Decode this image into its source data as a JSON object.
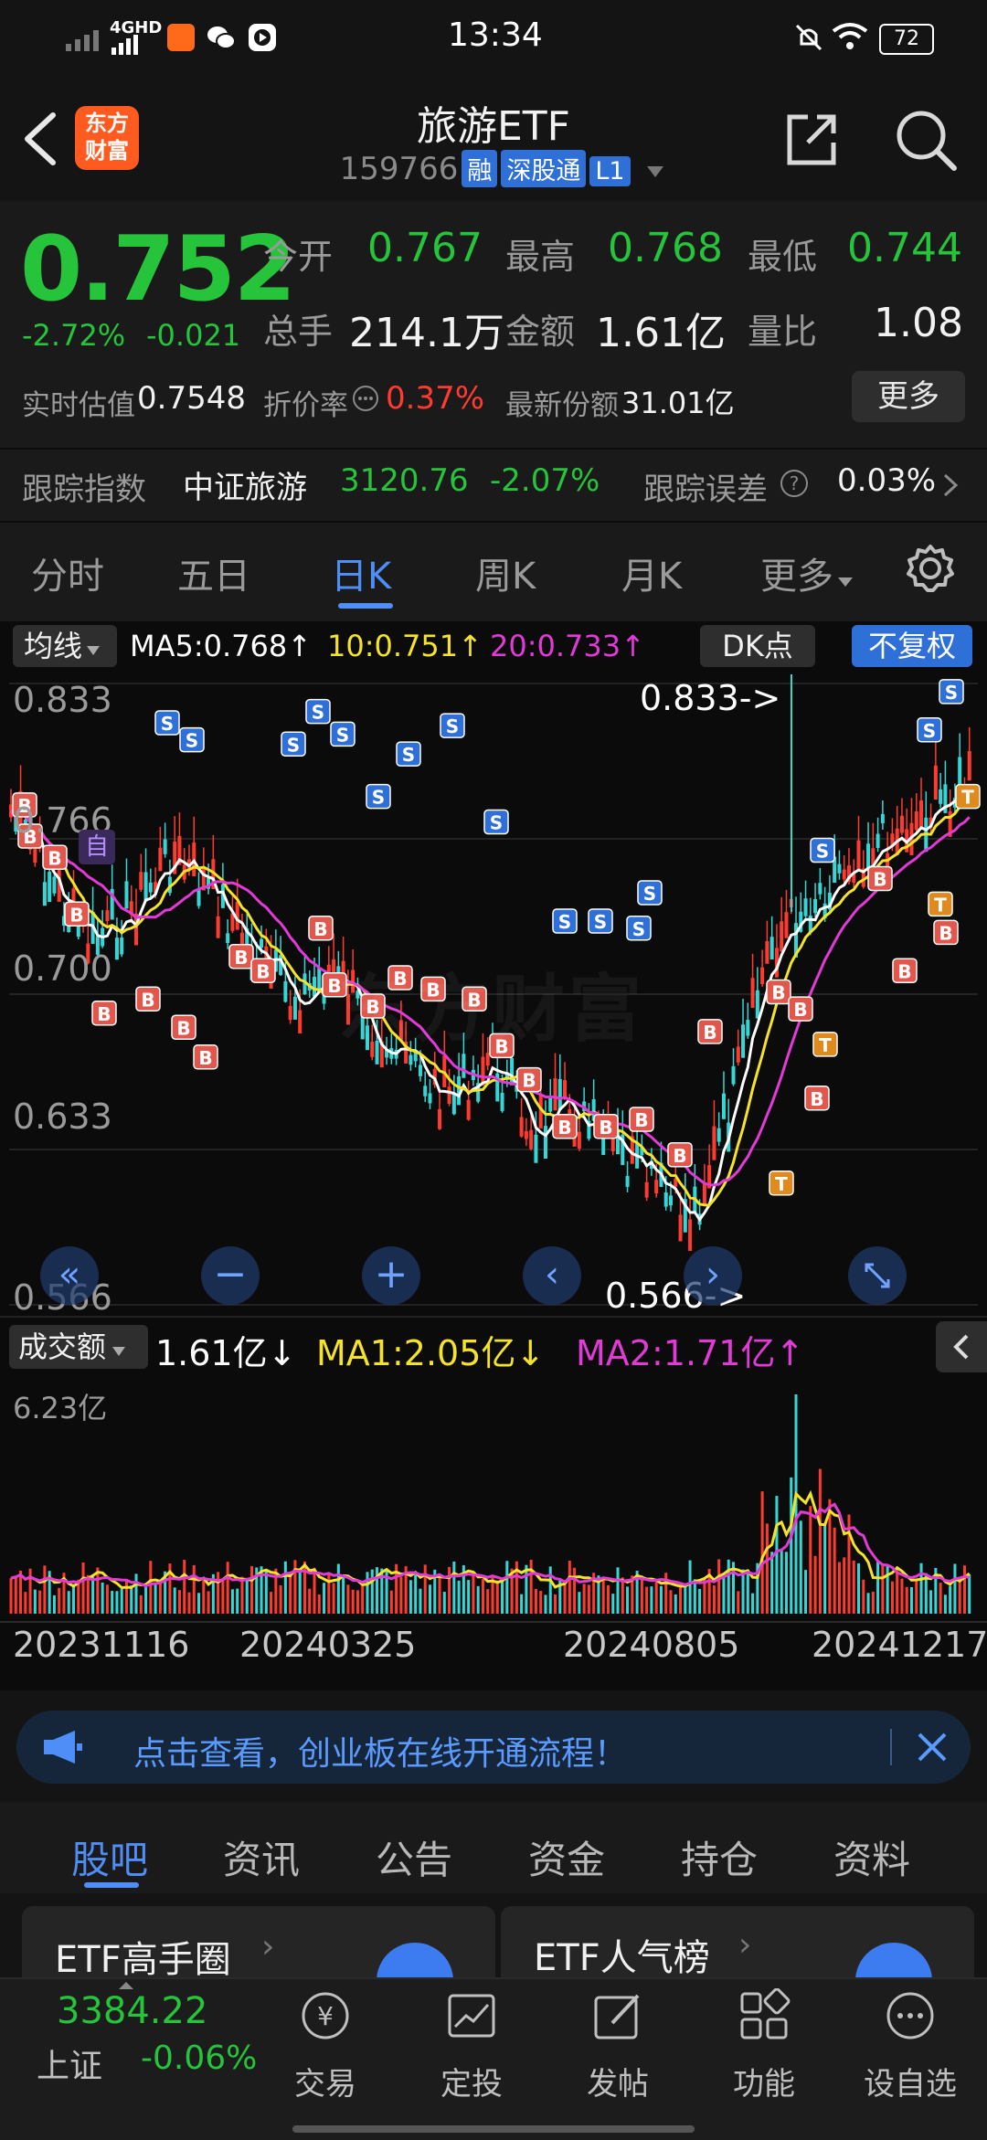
{
  "status_bar": {
    "network": "4GHD",
    "time": "13:34",
    "battery": "72"
  },
  "header": {
    "title": "旅游ETF",
    "code": "159766",
    "badges": [
      "融",
      "深股通",
      "L1"
    ],
    "logo_text_1": "东方",
    "logo_text_2": "财富"
  },
  "quote": {
    "price": "0.752",
    "change_pct": "-2.72%",
    "change": "-0.021",
    "open_label": "今开",
    "open": "0.767",
    "high_label": "最高",
    "high": "0.768",
    "low_label": "最低",
    "low": "0.744",
    "volume_label": "总手",
    "volume": "214.1万",
    "amount_label": "金额",
    "amount": "1.61亿",
    "ratio_label": "量比",
    "ratio": "1.08",
    "iopv_label": "实时估值",
    "iopv": "0.7548",
    "premium_label": "折价率",
    "premium": "0.37%",
    "shares_label": "最新份额",
    "shares": "31.01亿",
    "more_label": "更多",
    "index_label": "跟踪指数",
    "index_name": "中证旅游",
    "index_value": "3120.76",
    "index_change": "-2.07%",
    "error_label": "跟踪误差",
    "error_value": "0.03%"
  },
  "ktabs": {
    "items": [
      "分时",
      "五日",
      "日K",
      "周K",
      "月K",
      "更多"
    ],
    "active": "日K"
  },
  "chart": {
    "ma_selector": "均线",
    "ma5": "MA5:0.768",
    "ma10": "10:0.751",
    "ma20": "20:0.733",
    "dk_button": "DK点",
    "fq_button": "不复权",
    "y_labels": [
      "0.833",
      "0.766",
      "0.700",
      "0.633",
      "0.566"
    ],
    "max_marker": "0.833->",
    "min_marker": "0.566->",
    "self_tag": "自",
    "watermark": "东方财富",
    "vol_selector": "成交额",
    "vol_value": "1.61亿",
    "vol_ma1": "MA1:2.05亿",
    "vol_ma2": "MA2:1.71亿",
    "vol_max": "6.23亿",
    "dates": [
      "20231116",
      "20240325",
      "20240805",
      "20241217"
    ],
    "colors": {
      "up": "#ff3b30",
      "down": "#36d6d6",
      "ma5": "#ffffff",
      "ma10": "#f5e32a",
      "ma20": "#e23ad6"
    }
  },
  "notice": {
    "text": "点击查看，创业板在线开通流程！"
  },
  "subtabs": {
    "items": [
      "股吧",
      "资讯",
      "公告",
      "资金",
      "持仓",
      "资料"
    ],
    "active": "股吧"
  },
  "cards": {
    "left": "ETF高手圈",
    "right": "ETF人气榜"
  },
  "bottom_bar": {
    "index_value": "3384.22",
    "index_name": "上证",
    "index_change": "-0.06%",
    "items": [
      "交易",
      "定投",
      "发帖",
      "功能",
      "设自选"
    ]
  }
}
